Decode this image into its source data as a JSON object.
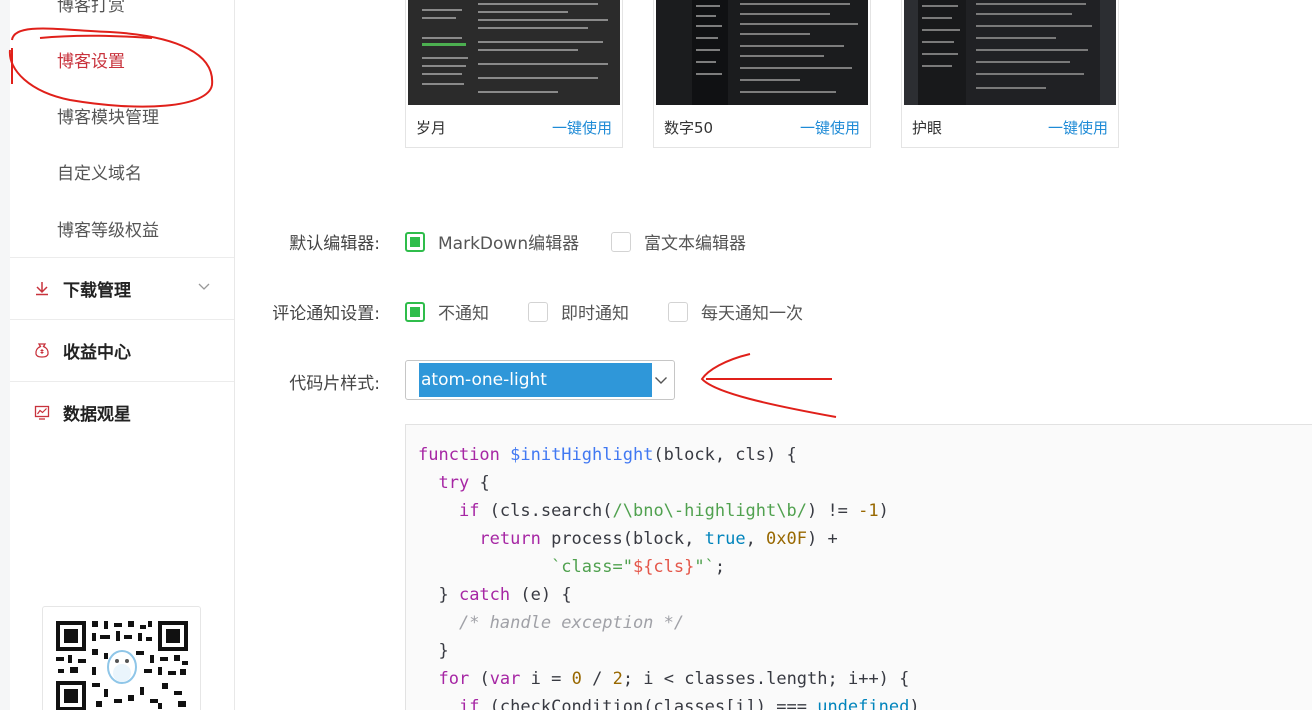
{
  "sidebar": {
    "sub_items": [
      "博客打赏",
      "博客设置",
      "博客模块管理",
      "自定义域名",
      "博客等级权益"
    ],
    "sections": [
      "下载管理",
      "收益中心",
      "数据观星"
    ]
  },
  "themes": [
    {
      "name": "岁月",
      "action": "一键使用"
    },
    {
      "name": "数字50",
      "action": "一键使用"
    },
    {
      "name": "护眼",
      "action": "一键使用"
    }
  ],
  "editor": {
    "label": "默认编辑器:",
    "options": [
      "MarkDown编辑器",
      "富文本编辑器"
    ],
    "selected": 0
  },
  "comment_notify": {
    "label": "评论通知设置:",
    "options": [
      "不通知",
      "即时通知",
      "每天通知一次"
    ],
    "selected": 0
  },
  "code_style": {
    "label": "代码片样式:",
    "value": "atom-one-light"
  },
  "code_lines": [
    [
      [
        "k",
        "function "
      ],
      [
        "f",
        "$initHighlight"
      ],
      [
        "p",
        "(block, cls) {"
      ]
    ],
    [
      [
        "p",
        "  "
      ],
      [
        "k",
        "try"
      ],
      [
        "p",
        " {"
      ]
    ],
    [
      [
        "p",
        "    "
      ],
      [
        "k",
        "if"
      ],
      [
        "p",
        " (cls.search("
      ],
      [
        "r",
        "/\\bno\\-highlight\\b/"
      ],
      [
        "p",
        ") != "
      ],
      [
        "n",
        "-1"
      ],
      [
        "p",
        ")"
      ]
    ],
    [
      [
        "p",
        "      "
      ],
      [
        "k",
        "return"
      ],
      [
        "p",
        " process(block, "
      ],
      [
        "b",
        "true"
      ],
      [
        "p",
        ", "
      ],
      [
        "n",
        "0x0F"
      ],
      [
        "p",
        ") +"
      ]
    ],
    [
      [
        "p",
        "             "
      ],
      [
        "s",
        "`class=\""
      ],
      [
        "v",
        "${cls}"
      ],
      [
        "s",
        "\"`"
      ],
      [
        "p",
        ";"
      ]
    ],
    [
      [
        "p",
        "  } "
      ],
      [
        "k",
        "catch"
      ],
      [
        "p",
        " (e) {"
      ]
    ],
    [
      [
        "p",
        "    "
      ],
      [
        "c",
        "/* handle exception */"
      ]
    ],
    [
      [
        "p",
        "  }"
      ]
    ],
    [
      [
        "p",
        "  "
      ],
      [
        "k",
        "for"
      ],
      [
        "p",
        " ("
      ],
      [
        "k",
        "var"
      ],
      [
        "p",
        " i = "
      ],
      [
        "n",
        "0"
      ],
      [
        "p",
        " / "
      ],
      [
        "n",
        "2"
      ],
      [
        "p",
        "; i < classes.length; i++) {"
      ]
    ],
    [
      [
        "p",
        "    "
      ],
      [
        "k",
        "if"
      ],
      [
        "p",
        " (checkCondition(classes[i]) === "
      ],
      [
        "b",
        "undefined"
      ],
      [
        "p",
        ")"
      ]
    ]
  ],
  "colors": {
    "accent_red": "#c8323c",
    "check_green": "#2fbd4b",
    "link_blue": "#1f8bd6",
    "select_blue": "#2f97d9",
    "annotation_red": "#e0201a"
  }
}
